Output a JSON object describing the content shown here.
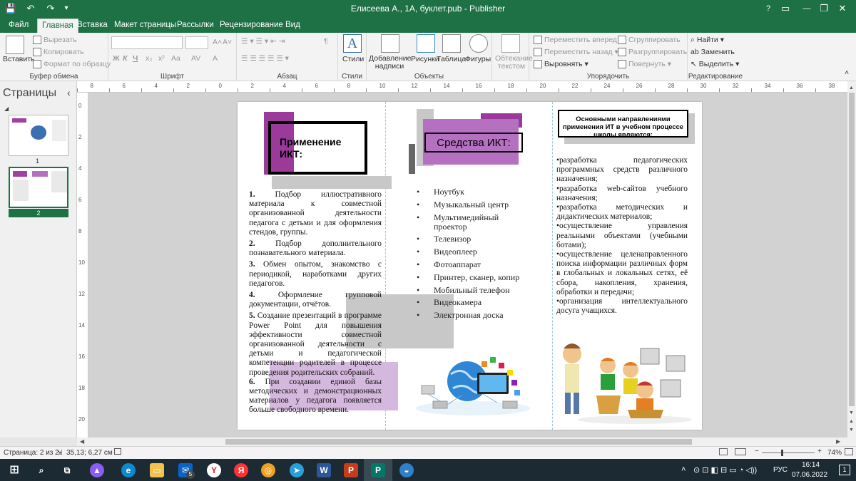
{
  "window": {
    "title": "Елисеева А., 1А, буклет.pub - Publisher",
    "help": "?",
    "minimize": "—",
    "restore": "❐",
    "close": "✕"
  },
  "qat": {
    "save": "💾",
    "undo": "↶",
    "redo": "↷",
    "more": "▾"
  },
  "tabs": [
    "Файл",
    "Главная",
    "Вставка",
    "Макет страницы",
    "Рассылки",
    "Рецензирование",
    "Вид"
  ],
  "active_tab": "Главная",
  "ribbon": {
    "clipboard": {
      "label": "Буфер обмена",
      "paste": "Вставить",
      "cut": "Вырезать",
      "copy": "Копировать",
      "format": "Формат по образцу"
    },
    "font": {
      "label": "Шрифт",
      "bold": "Ж",
      "italic": "К",
      "underline": "Ч",
      "sub": "x₂",
      "sup": "x²",
      "case": "Aa",
      "spacing": "AV",
      "color": "A",
      "grow": "A˄",
      "shrink": "A˅"
    },
    "paragraph": {
      "label": "Абзац",
      "pilcrow": "¶"
    },
    "styles": {
      "label": "Стили",
      "button": "Стили"
    },
    "objects": {
      "label": "Объекты",
      "textbox": "Добавление надписи",
      "pictures": "Рисунки",
      "table": "Таблица",
      "shapes": "Фигуры"
    },
    "wrap": "Обтекание текстом",
    "arrange": {
      "label": "Упорядочить",
      "forward": "Переместить вперед",
      "backward": "Переместить назад",
      "align": "Выровнять",
      "group": "Сгруппировать",
      "ungroup": "Разгруппировать",
      "rotate": "Повернуть"
    },
    "editing": {
      "label": "Редактирование",
      "find": "Найти",
      "replace": "Заменить",
      "select": "Выделить"
    }
  },
  "pages_pane": {
    "title": "Страницы",
    "collapse": "‹",
    "pages": [
      {
        "num": "1"
      },
      {
        "num": "2"
      }
    ]
  },
  "ruler_h": [
    "8",
    "6",
    "4",
    "2",
    "0",
    "2",
    "4",
    "6",
    "8",
    "10",
    "12",
    "14",
    "16",
    "18",
    "20",
    "22",
    "24",
    "26",
    "28",
    "30",
    "32",
    "34",
    "36",
    "38"
  ],
  "ruler_v": [
    "0",
    "2",
    "4",
    "6",
    "8",
    "10",
    "12",
    "14",
    "16",
    "18",
    "20"
  ],
  "col1": {
    "title": "Применение ИКТ:",
    "items": [
      {
        "num": "1.",
        "text": "Подбор иллюстративного материала к совместной организованной деятельности педагога с детьми и для оформления стендов, группы."
      },
      {
        "num": "2.",
        "text": "Подбор дополнительного познавательного материала."
      },
      {
        "num": "3.",
        "text": "Обмен опытом, знакомство с периодикой, наработками других педагогов."
      },
      {
        "num": "4.",
        "text": "Оформление групповой документации, отчётов."
      },
      {
        "num": "5.",
        "text": "Создание презентаций в программе Power Point для повышения эффективности совместной организованной деятельности с детьми и педагогической компетенции родителей в процессе проведения родительских собраний."
      },
      {
        "num": "6.",
        "text": "При создании единой базы методических и демонстрационных материалов у педагога появляется больше свободного времени."
      }
    ]
  },
  "col2": {
    "title": "Средства ИКТ:",
    "items": [
      "Ноутбук",
      "Музыкальный центр",
      "Мультимедийный проектор",
      "Телевизор",
      "Видеоплеер",
      "Фотоаппарат",
      "Принтер, сканер, копир",
      "Мобильный телефон",
      "Видеокамера",
      "Электронная доска"
    ]
  },
  "col3": {
    "title": "Основными направлениями применения ИТ в учебном процессе школы являются:",
    "items": [
      "•разработка педагогических программных средств различного назначения;",
      "•разработка web-сайтов учебного назначения;",
      "•разработка методических и дидактических материалов;",
      "•осуществление управления реальными объектами (учебными ботами);",
      "•осуществление целенаправленного поиска информации различных форм в глобальных и локальных сетях, её сбора, накопления, хранения, обработки и передачи;",
      "•организация интеллектуального досуга учащихся."
    ]
  },
  "status": {
    "page": "Страница: 2 из 2",
    "position": "35,13; 6,27 см",
    "zoom": "74%",
    "zoom_level": 0.74,
    "zoom_minus": "−",
    "zoom_plus": "+"
  },
  "taskbar": {
    "time": "16:14",
    "date": "07.06.2022",
    "lang": "РУС",
    "notif": "1",
    "mail_badge": "5"
  },
  "colors": {
    "brand": "#1e7145",
    "purple": "#9c3a9c",
    "violet": "#b670c2",
    "lilac": "#d5b8dd",
    "gray": "#c8c8c8"
  }
}
